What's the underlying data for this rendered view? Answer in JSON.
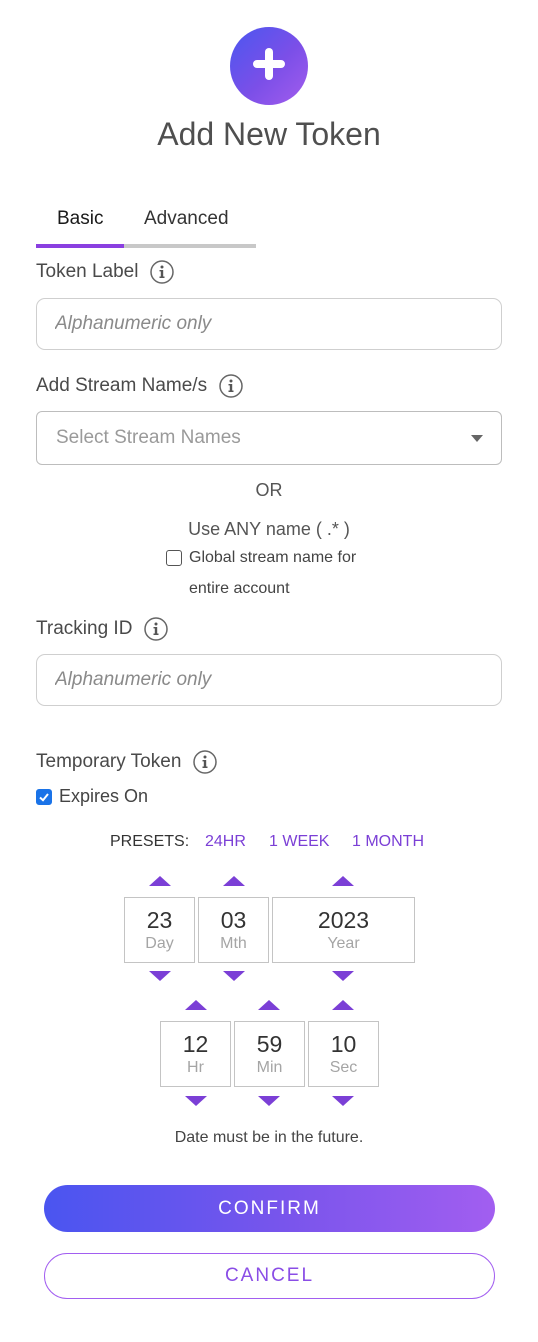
{
  "header": {
    "title": "Add New Token",
    "add_icon": "plus-icon"
  },
  "tabs": [
    {
      "label": "Basic",
      "active": true
    },
    {
      "label": "Advanced",
      "active": false
    }
  ],
  "token_label": {
    "label": "Token Label",
    "placeholder": "Alphanumeric only",
    "value": ""
  },
  "stream_names": {
    "label": "Add Stream Name/s",
    "placeholder": "Select Stream Names"
  },
  "or_text": "OR",
  "any_name": {
    "text": "Use ANY name ( .* )",
    "checkbox_line1": "Global stream name for",
    "checkbox_line2": "entire account",
    "checked": false
  },
  "tracking_id": {
    "label": "Tracking ID",
    "placeholder": "Alphanumeric only",
    "value": ""
  },
  "temporary_token": {
    "label": "Temporary Token",
    "expires_label": "Expires On",
    "expires_checked": true
  },
  "presets": {
    "label": "PRESETS:",
    "options": [
      "24HR",
      "1 WEEK",
      "1 MONTH"
    ]
  },
  "date": {
    "day": {
      "value": "23",
      "unit": "Day"
    },
    "month": {
      "value": "03",
      "unit": "Mth"
    },
    "year": {
      "value": "2023",
      "unit": "Year"
    }
  },
  "time": {
    "hour": {
      "value": "12",
      "unit": "Hr"
    },
    "minute": {
      "value": "59",
      "unit": "Min"
    },
    "second": {
      "value": "10",
      "unit": "Sec"
    }
  },
  "hint": "Date must be in the future.",
  "actions": {
    "confirm": "CONFIRM",
    "cancel": "CANCEL"
  },
  "colors": {
    "accent": "#7b3fd6",
    "gradient_start": "#4a55f0",
    "gradient_end": "#a25ef0",
    "checkbox": "#1a73e8"
  }
}
